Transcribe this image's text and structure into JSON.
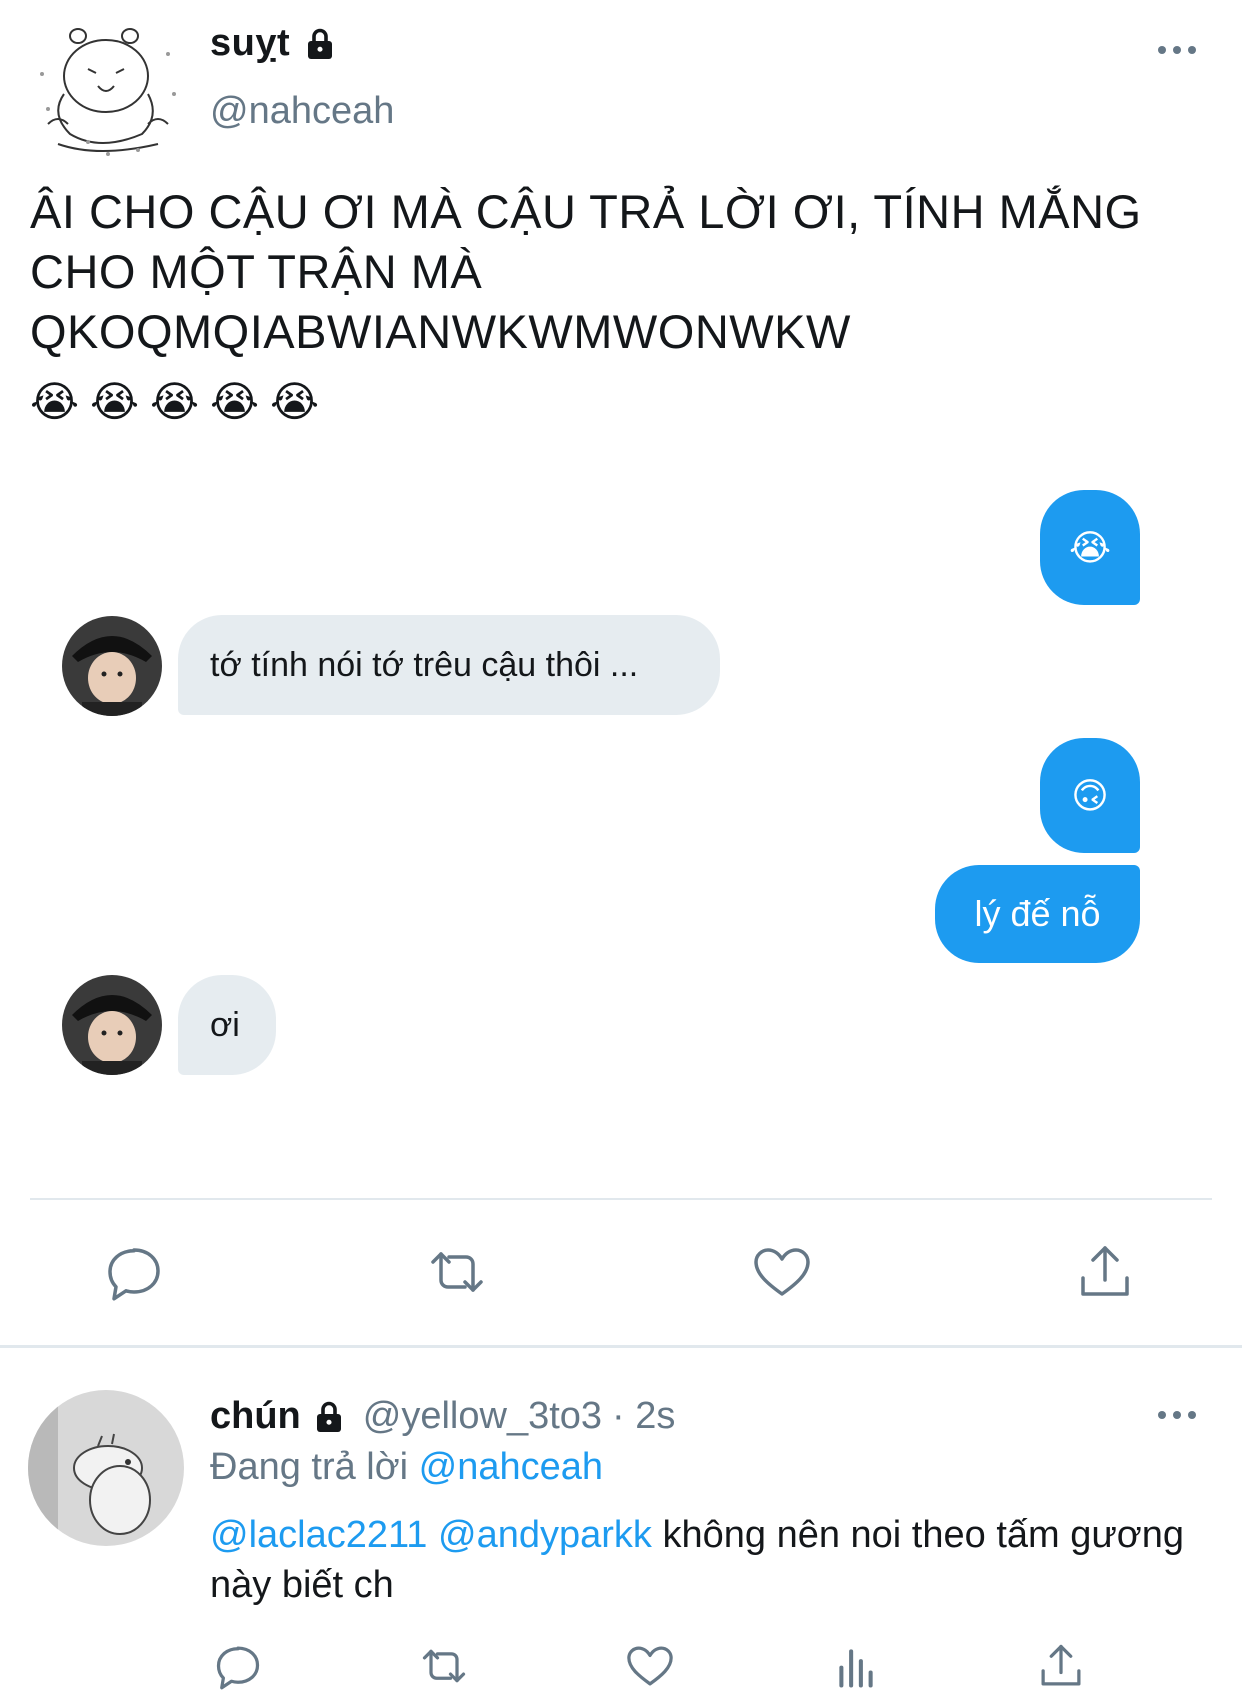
{
  "tweet": {
    "author_name": "suỵt",
    "author_handle": "@nahceah",
    "text": "ÂI CHO CẬU ƠI MÀ CẬU TRẢ LỜI ƠI, TÍNH MẮNG CHO MỘT TRẬN MÀ QKOQMQIABWIANWKWMWONWKW",
    "emoji_row": [
      "😭",
      "😭",
      "😭",
      "😭",
      "😭"
    ]
  },
  "chat": {
    "messages": [
      {
        "side": "right",
        "text": "😭"
      },
      {
        "side": "left",
        "text": "tớ tính nói tớ trêu cậu thôi ..."
      },
      {
        "side": "right",
        "text": "🙃"
      },
      {
        "side": "right",
        "text": "lý đế nỗ"
      },
      {
        "side": "left",
        "text": "ơi"
      }
    ]
  },
  "actions": [
    "reply-icon",
    "retweet-icon",
    "like-icon",
    "share-icon"
  ],
  "reply": {
    "name": "chún",
    "handle": "@yellow_3to3",
    "time": "· 2s",
    "replying_label": "Đang trả lời",
    "replying_to": "@nahceah",
    "mention1": "@laclac2211",
    "mention2": "@andyparkk",
    "text": "không nên noi theo tấm gương này biết ch"
  },
  "reply_actions": [
    "reply-icon",
    "retweet-icon",
    "like-icon",
    "analytics-icon",
    "share-icon"
  ],
  "colors": {
    "accent": "#1d9bf0",
    "muted": "#657786",
    "bubble_gray": "#e6ecf0"
  }
}
